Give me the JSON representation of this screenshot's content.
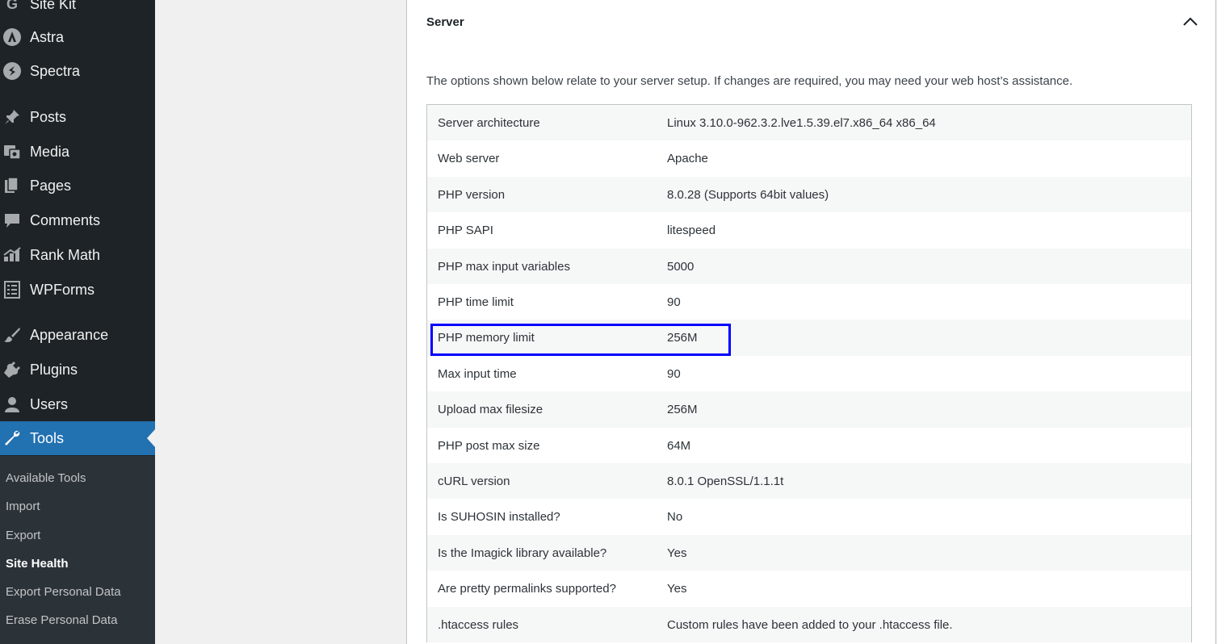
{
  "sidebar": {
    "menu": [
      {
        "label": "Site Kit",
        "icon": "sitekit-icon"
      },
      {
        "label": "Astra",
        "icon": "astra-icon"
      },
      {
        "label": "Spectra",
        "icon": "spectra-icon"
      },
      {
        "label": "Posts",
        "icon": "pin-icon"
      },
      {
        "label": "Media",
        "icon": "media-icon"
      },
      {
        "label": "Pages",
        "icon": "pages-icon"
      },
      {
        "label": "Comments",
        "icon": "comment-icon"
      },
      {
        "label": "Rank Math",
        "icon": "rankmath-icon"
      },
      {
        "label": "WPForms",
        "icon": "wpforms-icon"
      },
      {
        "label": "Appearance",
        "icon": "brush-icon"
      },
      {
        "label": "Plugins",
        "icon": "plugin-icon"
      },
      {
        "label": "Users",
        "icon": "user-icon"
      },
      {
        "label": "Tools",
        "icon": "wrench-icon"
      }
    ],
    "submenu": [
      {
        "label": "Available Tools"
      },
      {
        "label": "Import"
      },
      {
        "label": "Export"
      },
      {
        "label": "Site Health"
      },
      {
        "label": "Export Personal Data"
      },
      {
        "label": "Erase Personal Data"
      }
    ]
  },
  "panel": {
    "title": "Server",
    "description": "The options shown below relate to your server setup. If changes are required, you may need your web host’s assistance.",
    "rows": [
      {
        "label": "Server architecture",
        "value": "Linux 3.10.0-962.3.2.lve1.5.39.el7.x86_64 x86_64"
      },
      {
        "label": "Web server",
        "value": "Apache"
      },
      {
        "label": "PHP version",
        "value": "8.0.28 (Supports 64bit values)"
      },
      {
        "label": "PHP SAPI",
        "value": "litespeed"
      },
      {
        "label": "PHP max input variables",
        "value": "5000"
      },
      {
        "label": "PHP time limit",
        "value": "90"
      },
      {
        "label": "PHP memory limit",
        "value": "256M"
      },
      {
        "label": "Max input time",
        "value": "90"
      },
      {
        "label": "Upload max filesize",
        "value": "256M"
      },
      {
        "label": "PHP post max size",
        "value": "64M"
      },
      {
        "label": "cURL version",
        "value": "8.0.1 OpenSSL/1.1.1t"
      },
      {
        "label": "Is SUHOSIN installed?",
        "value": "No"
      },
      {
        "label": "Is the Imagick library available?",
        "value": "Yes"
      },
      {
        "label": "Are pretty permalinks supported?",
        "value": "Yes"
      },
      {
        "label": ".htaccess rules",
        "value": "Custom rules have been added to your .htaccess file."
      }
    ]
  },
  "colors": {
    "sidebar_bg": "#1d2327",
    "submenu_bg": "#2c3338",
    "active_bg": "#2271b1",
    "highlight_border": "#0000ff"
  }
}
